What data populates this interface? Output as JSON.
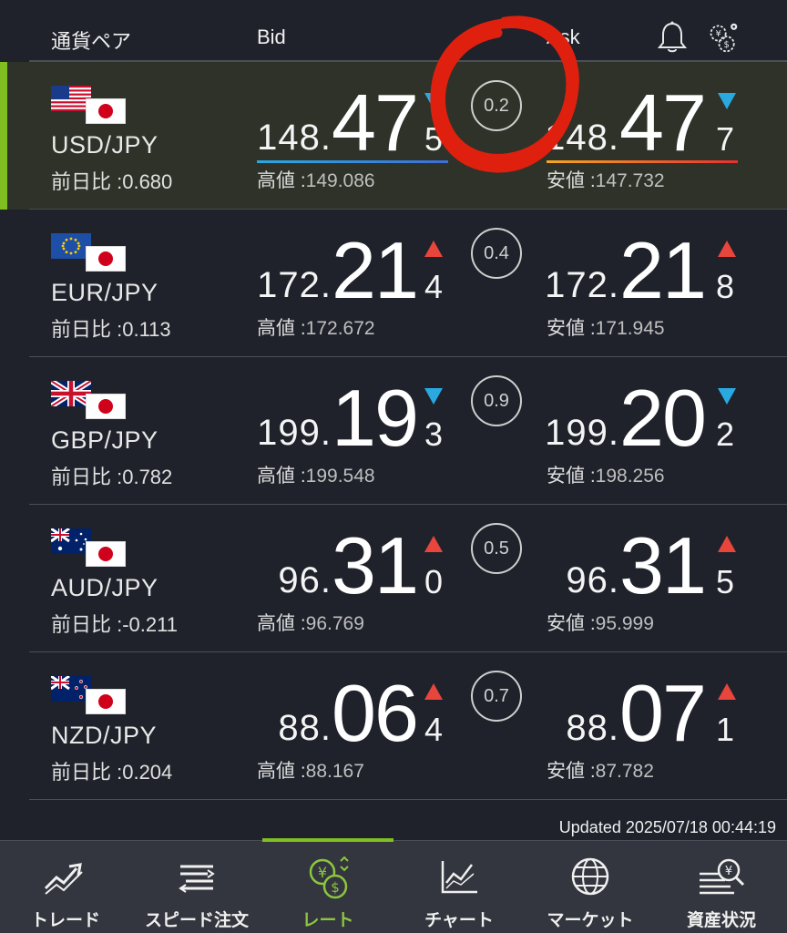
{
  "header": {
    "pair_label": "通貨ペア",
    "bid_label": "Bid",
    "ask_label": "Ask",
    "bell_icon": "bell-icon",
    "settings_icon": "currency-gears-icon"
  },
  "rows": [
    {
      "pair": "USD/JPY",
      "flag": "us-flag",
      "change": "前日比 :0.680",
      "bid": {
        "pre": "148.",
        "big": "47",
        "small": "5",
        "arrow": "down"
      },
      "ask": {
        "pre": "148.",
        "big": "47",
        "small": "7",
        "arrow": "down"
      },
      "spread": "0.2",
      "high_label": "高値 :",
      "high": "149.086",
      "low_label": "安値 :",
      "low": "147.732",
      "active": true
    },
    {
      "pair": "EUR/JPY",
      "flag": "eu-flag",
      "change": "前日比 :0.113",
      "bid": {
        "pre": "172.",
        "big": "21",
        "small": "4",
        "arrow": "up"
      },
      "ask": {
        "pre": "172.",
        "big": "21",
        "small": "8",
        "arrow": "up"
      },
      "spread": "0.4",
      "high_label": "高値 :",
      "high": "172.672",
      "low_label": "安値 :",
      "low": "171.945",
      "active": false
    },
    {
      "pair": "GBP/JPY",
      "flag": "uk-flag",
      "change": "前日比 :0.782",
      "bid": {
        "pre": "199.",
        "big": "19",
        "small": "3",
        "arrow": "down"
      },
      "ask": {
        "pre": "199.",
        "big": "20",
        "small": "2",
        "arrow": "down"
      },
      "spread": "0.9",
      "high_label": "高値 :",
      "high": "199.548",
      "low_label": "安値 :",
      "low": "198.256",
      "active": false
    },
    {
      "pair": "AUD/JPY",
      "flag": "au-flag",
      "change": "前日比 :-0.211",
      "bid": {
        "pre": "96.",
        "big": "31",
        "small": "0",
        "arrow": "up"
      },
      "ask": {
        "pre": "96.",
        "big": "31",
        "small": "5",
        "arrow": "up"
      },
      "spread": "0.5",
      "high_label": "高値 :",
      "high": "96.769",
      "low_label": "安値 :",
      "low": "95.999",
      "active": false
    },
    {
      "pair": "NZD/JPY",
      "flag": "nz-flag",
      "change": "前日比 :0.204",
      "bid": {
        "pre": "88.",
        "big": "06",
        "small": "4",
        "arrow": "up"
      },
      "ask": {
        "pre": "88.",
        "big": "07",
        "small": "1",
        "arrow": "up"
      },
      "spread": "0.7",
      "high_label": "高値 :",
      "high": "88.167",
      "low_label": "安値 :",
      "low": "87.782",
      "active": false
    }
  ],
  "updated": "Updated  2025/07/18 00:44:19",
  "tabs": [
    {
      "label": "トレード",
      "icon": "trade-chart-icon",
      "active": false
    },
    {
      "label": "スピード注文",
      "icon": "speed-order-icon",
      "active": false
    },
    {
      "label": "レート",
      "icon": "rate-yen-dollar-icon",
      "active": true
    },
    {
      "label": "チャート",
      "icon": "chart-icon",
      "active": false
    },
    {
      "label": "マーケット",
      "icon": "globe-icon",
      "active": false
    },
    {
      "label": "資産状況",
      "icon": "assets-search-icon",
      "active": false
    }
  ],
  "colors": {
    "background": "#1f222b",
    "active_row": "#2e3228",
    "accent_green": "#7fbf1f",
    "up_red": "#e8453c",
    "down_blue": "#2aa9e0",
    "annotation_red": "#e0200f"
  }
}
